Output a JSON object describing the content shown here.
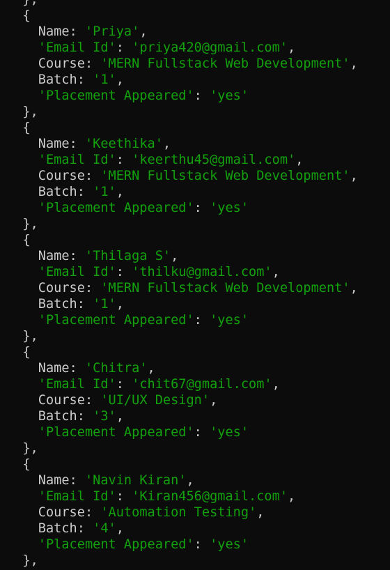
{
  "theme": {
    "background": "#0c0c0c",
    "text": "#cccccc",
    "string": "#13a10e"
  },
  "lines": [
    {
      "indent": "  ",
      "parts": [
        {
          "t": "},",
          "c": "punct"
        }
      ]
    },
    {
      "indent": "  ",
      "parts": [
        {
          "t": "{",
          "c": "punct"
        }
      ]
    },
    {
      "indent": "    ",
      "parts": [
        {
          "t": "Name",
          "c": "key"
        },
        {
          "t": ": ",
          "c": "punct"
        },
        {
          "t": "'Priya'",
          "c": "str"
        },
        {
          "t": ",",
          "c": "punct"
        }
      ]
    },
    {
      "indent": "    ",
      "parts": [
        {
          "t": "'Email Id'",
          "c": "str"
        },
        {
          "t": ": ",
          "c": "punct"
        },
        {
          "t": "'priya420@gmail.com'",
          "c": "str"
        },
        {
          "t": ",",
          "c": "punct"
        }
      ]
    },
    {
      "indent": "    ",
      "parts": [
        {
          "t": "Course",
          "c": "key"
        },
        {
          "t": ": ",
          "c": "punct"
        },
        {
          "t": "'MERN Fullstack Web Development'",
          "c": "str"
        },
        {
          "t": ",",
          "c": "punct"
        }
      ]
    },
    {
      "indent": "    ",
      "parts": [
        {
          "t": "Batch",
          "c": "key"
        },
        {
          "t": ": ",
          "c": "punct"
        },
        {
          "t": "'1'",
          "c": "str"
        },
        {
          "t": ",",
          "c": "punct"
        }
      ]
    },
    {
      "indent": "    ",
      "parts": [
        {
          "t": "'Placement Appeared'",
          "c": "str"
        },
        {
          "t": ": ",
          "c": "punct"
        },
        {
          "t": "'yes'",
          "c": "str"
        }
      ]
    },
    {
      "indent": "  ",
      "parts": [
        {
          "t": "},",
          "c": "punct"
        }
      ]
    },
    {
      "indent": "  ",
      "parts": [
        {
          "t": "{",
          "c": "punct"
        }
      ]
    },
    {
      "indent": "    ",
      "parts": [
        {
          "t": "Name",
          "c": "key"
        },
        {
          "t": ": ",
          "c": "punct"
        },
        {
          "t": "'Keethika'",
          "c": "str"
        },
        {
          "t": ",",
          "c": "punct"
        }
      ]
    },
    {
      "indent": "    ",
      "parts": [
        {
          "t": "'Email Id'",
          "c": "str"
        },
        {
          "t": ": ",
          "c": "punct"
        },
        {
          "t": "'keerthu45@gmail.com'",
          "c": "str"
        },
        {
          "t": ",",
          "c": "punct"
        }
      ]
    },
    {
      "indent": "    ",
      "parts": [
        {
          "t": "Course",
          "c": "key"
        },
        {
          "t": ": ",
          "c": "punct"
        },
        {
          "t": "'MERN Fullstack Web Development'",
          "c": "str"
        },
        {
          "t": ",",
          "c": "punct"
        }
      ]
    },
    {
      "indent": "    ",
      "parts": [
        {
          "t": "Batch",
          "c": "key"
        },
        {
          "t": ": ",
          "c": "punct"
        },
        {
          "t": "'1'",
          "c": "str"
        },
        {
          "t": ",",
          "c": "punct"
        }
      ]
    },
    {
      "indent": "    ",
      "parts": [
        {
          "t": "'Placement Appeared'",
          "c": "str"
        },
        {
          "t": ": ",
          "c": "punct"
        },
        {
          "t": "'yes'",
          "c": "str"
        }
      ]
    },
    {
      "indent": "  ",
      "parts": [
        {
          "t": "},",
          "c": "punct"
        }
      ]
    },
    {
      "indent": "  ",
      "parts": [
        {
          "t": "{",
          "c": "punct"
        }
      ]
    },
    {
      "indent": "    ",
      "parts": [
        {
          "t": "Name",
          "c": "key"
        },
        {
          "t": ": ",
          "c": "punct"
        },
        {
          "t": "'Thilaga S'",
          "c": "str"
        },
        {
          "t": ",",
          "c": "punct"
        }
      ]
    },
    {
      "indent": "    ",
      "parts": [
        {
          "t": "'Email Id'",
          "c": "str"
        },
        {
          "t": ": ",
          "c": "punct"
        },
        {
          "t": "'thilku@gmail.com'",
          "c": "str"
        },
        {
          "t": ",",
          "c": "punct"
        }
      ]
    },
    {
      "indent": "    ",
      "parts": [
        {
          "t": "Course",
          "c": "key"
        },
        {
          "t": ": ",
          "c": "punct"
        },
        {
          "t": "'MERN Fullstack Web Development'",
          "c": "str"
        },
        {
          "t": ",",
          "c": "punct"
        }
      ]
    },
    {
      "indent": "    ",
      "parts": [
        {
          "t": "Batch",
          "c": "key"
        },
        {
          "t": ": ",
          "c": "punct"
        },
        {
          "t": "'1'",
          "c": "str"
        },
        {
          "t": ",",
          "c": "punct"
        }
      ]
    },
    {
      "indent": "    ",
      "parts": [
        {
          "t": "'Placement Appeared'",
          "c": "str"
        },
        {
          "t": ": ",
          "c": "punct"
        },
        {
          "t": "'yes'",
          "c": "str"
        }
      ]
    },
    {
      "indent": "  ",
      "parts": [
        {
          "t": "},",
          "c": "punct"
        }
      ]
    },
    {
      "indent": "  ",
      "parts": [
        {
          "t": "{",
          "c": "punct"
        }
      ]
    },
    {
      "indent": "    ",
      "parts": [
        {
          "t": "Name",
          "c": "key"
        },
        {
          "t": ": ",
          "c": "punct"
        },
        {
          "t": "'Chitra'",
          "c": "str"
        },
        {
          "t": ",",
          "c": "punct"
        }
      ]
    },
    {
      "indent": "    ",
      "parts": [
        {
          "t": "'Email Id'",
          "c": "str"
        },
        {
          "t": ": ",
          "c": "punct"
        },
        {
          "t": "'chit67@gmail.com'",
          "c": "str"
        },
        {
          "t": ",",
          "c": "punct"
        }
      ]
    },
    {
      "indent": "    ",
      "parts": [
        {
          "t": "Course",
          "c": "key"
        },
        {
          "t": ": ",
          "c": "punct"
        },
        {
          "t": "'UI/UX Design'",
          "c": "str"
        },
        {
          "t": ",",
          "c": "punct"
        }
      ]
    },
    {
      "indent": "    ",
      "parts": [
        {
          "t": "Batch",
          "c": "key"
        },
        {
          "t": ": ",
          "c": "punct"
        },
        {
          "t": "'3'",
          "c": "str"
        },
        {
          "t": ",",
          "c": "punct"
        }
      ]
    },
    {
      "indent": "    ",
      "parts": [
        {
          "t": "'Placement Appeared'",
          "c": "str"
        },
        {
          "t": ": ",
          "c": "punct"
        },
        {
          "t": "'yes'",
          "c": "str"
        }
      ]
    },
    {
      "indent": "  ",
      "parts": [
        {
          "t": "},",
          "c": "punct"
        }
      ]
    },
    {
      "indent": "  ",
      "parts": [
        {
          "t": "{",
          "c": "punct"
        }
      ]
    },
    {
      "indent": "    ",
      "parts": [
        {
          "t": "Name",
          "c": "key"
        },
        {
          "t": ": ",
          "c": "punct"
        },
        {
          "t": "'Navin Kiran'",
          "c": "str"
        },
        {
          "t": ",",
          "c": "punct"
        }
      ]
    },
    {
      "indent": "    ",
      "parts": [
        {
          "t": "'Email Id'",
          "c": "str"
        },
        {
          "t": ": ",
          "c": "punct"
        },
        {
          "t": "'Kiran456@gmail.com'",
          "c": "str"
        },
        {
          "t": ",",
          "c": "punct"
        }
      ]
    },
    {
      "indent": "    ",
      "parts": [
        {
          "t": "Course",
          "c": "key"
        },
        {
          "t": ": ",
          "c": "punct"
        },
        {
          "t": "'Automation Testing'",
          "c": "str"
        },
        {
          "t": ",",
          "c": "punct"
        }
      ]
    },
    {
      "indent": "    ",
      "parts": [
        {
          "t": "Batch",
          "c": "key"
        },
        {
          "t": ": ",
          "c": "punct"
        },
        {
          "t": "'4'",
          "c": "str"
        },
        {
          "t": ",",
          "c": "punct"
        }
      ]
    },
    {
      "indent": "    ",
      "parts": [
        {
          "t": "'Placement Appeared'",
          "c": "str"
        },
        {
          "t": ": ",
          "c": "punct"
        },
        {
          "t": "'yes'",
          "c": "str"
        }
      ]
    },
    {
      "indent": "  ",
      "parts": [
        {
          "t": "},",
          "c": "punct"
        }
      ]
    }
  ]
}
